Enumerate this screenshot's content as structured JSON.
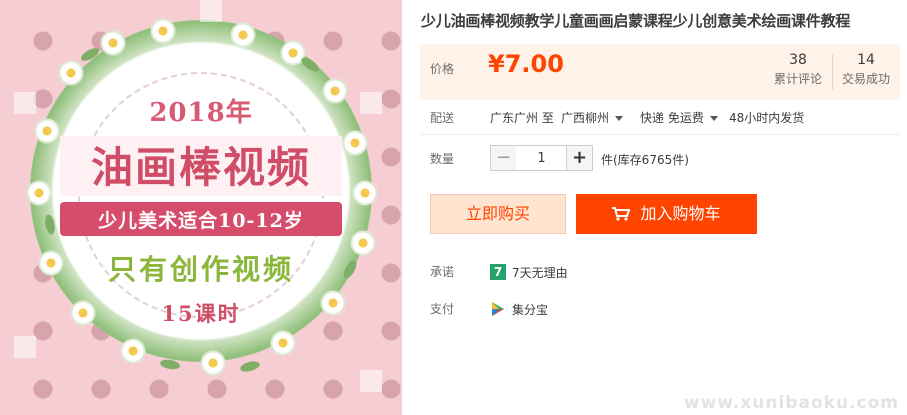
{
  "image": {
    "year_text": "2018年",
    "title_text": "油画棒视频",
    "ribbon_text": "少儿美术适合10-12岁",
    "subtitle_text": "只有创作视频",
    "hours_text": "15课时",
    "colors": {
      "background": "#f6cdd3",
      "title": "#d04d68",
      "subtitle": "#8ab63a"
    }
  },
  "product": {
    "title": "少儿油画棒视频教学儿童画画启蒙课程少儿创意美术绘画课件教程"
  },
  "price": {
    "label": "价格",
    "value": "¥7.00",
    "stats": [
      {
        "value": "38",
        "label": "累计评论"
      },
      {
        "value": "14",
        "label": "交易成功"
      }
    ],
    "colors": {
      "price": "#ff4400",
      "box": "#fff2e8"
    }
  },
  "delivery": {
    "label": "配送",
    "from": "广东广州 至",
    "to": "广西柳州",
    "shipping": "快递 免运费",
    "dispatch": "48小时内发货"
  },
  "quantity": {
    "label": "数量",
    "value": "1",
    "minus": "−",
    "plus": "+",
    "stock": "件(库存6765件)"
  },
  "actions": {
    "buy_now": "立即购买",
    "add_to_cart": "加入购物车",
    "colors": {
      "primary": "#ff4400",
      "secondary_bg": "#ffe4d0"
    }
  },
  "promise": {
    "label": "承诺",
    "badge": "7",
    "text": "7天无理由"
  },
  "payment": {
    "label": "支付",
    "text": "集分宝",
    "icon": "jifenbao-icon"
  },
  "watermark": "www.xunibaoku.com"
}
